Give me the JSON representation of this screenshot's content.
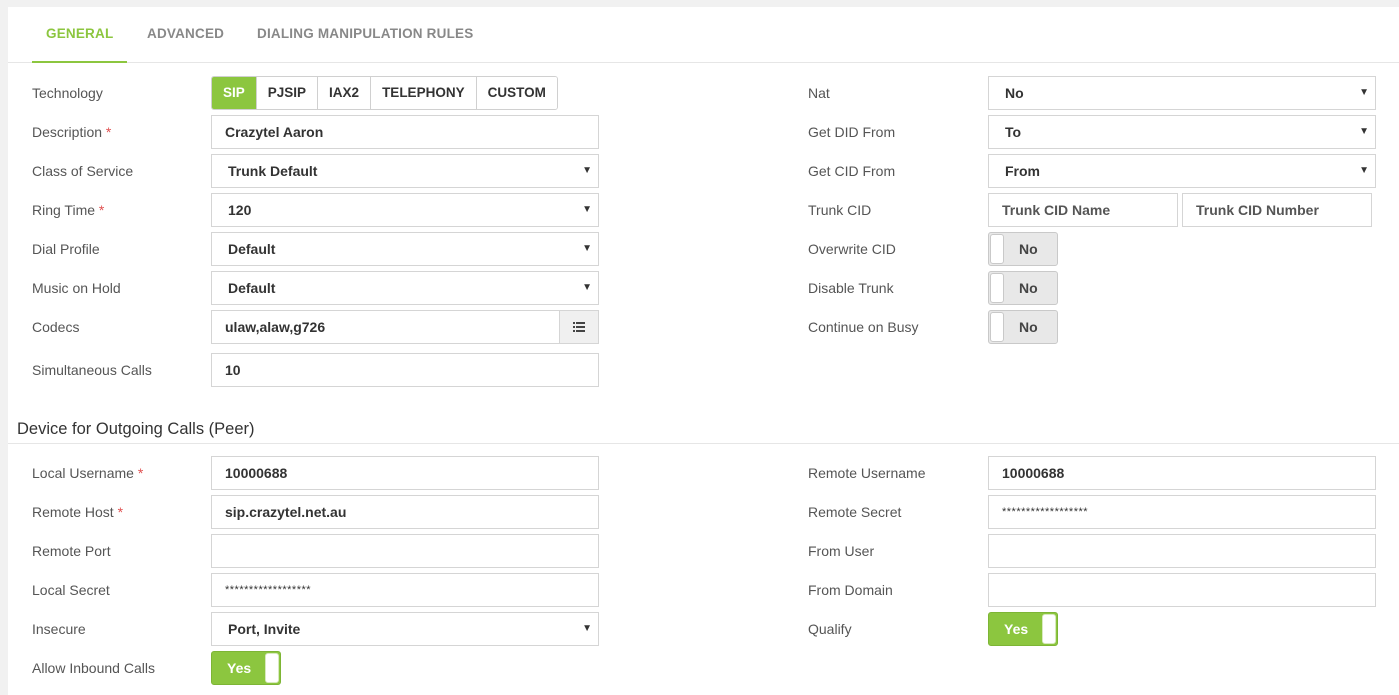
{
  "tabs": [
    "GENERAL",
    "ADVANCED",
    "DIALING MANIPULATION RULES"
  ],
  "technology": {
    "label": "Technology",
    "options": [
      "SIP",
      "PJSIP",
      "IAX2",
      "TELEPHONY",
      "CUSTOM"
    ],
    "selected": "SIP"
  },
  "description": {
    "label": "Description",
    "required": "*",
    "value": "Crazytel Aaron"
  },
  "class_of_service": {
    "label": "Class of Service",
    "value": "Trunk Default"
  },
  "ring_time": {
    "label": "Ring Time",
    "required": "*",
    "value": "120"
  },
  "dial_profile": {
    "label": "Dial Profile",
    "value": "Default"
  },
  "music_on_hold": {
    "label": "Music on Hold",
    "value": "Default"
  },
  "codecs": {
    "label": "Codecs",
    "value": "ulaw,alaw,g726",
    "icon": "list-icon"
  },
  "simultaneous_calls": {
    "label": "Simultaneous Calls",
    "value": "10"
  },
  "nat": {
    "label": "Nat",
    "value": "No"
  },
  "get_did_from": {
    "label": "Get DID From",
    "value": "To"
  },
  "get_cid_from": {
    "label": "Get CID From",
    "value": "From"
  },
  "trunk_cid": {
    "label": "Trunk CID",
    "name_placeholder": "Trunk CID Name",
    "number_placeholder": "Trunk CID Number"
  },
  "overwrite_cid": {
    "label": "Overwrite CID",
    "value": "No"
  },
  "disable_trunk": {
    "label": "Disable Trunk",
    "value": "No"
  },
  "continue_on_busy": {
    "label": "Continue on Busy",
    "value": "No"
  },
  "peer_section": {
    "title": "Device for Outgoing Calls (Peer)",
    "local_username": {
      "label": "Local Username",
      "required": "*",
      "value": "10000688"
    },
    "remote_host": {
      "label": "Remote Host",
      "required": "*",
      "value": "sip.crazytel.net.au"
    },
    "remote_port": {
      "label": "Remote Port",
      "value": ""
    },
    "local_secret": {
      "label": "Local Secret",
      "value": "******************"
    },
    "insecure": {
      "label": "Insecure",
      "value": "Port, Invite"
    },
    "allow_inbound_calls": {
      "label": "Allow Inbound Calls",
      "value": "Yes"
    },
    "remote_username": {
      "label": "Remote Username",
      "value": "10000688"
    },
    "remote_secret": {
      "label": "Remote Secret",
      "value": "******************"
    },
    "from_user": {
      "label": "From User",
      "value": ""
    },
    "from_domain": {
      "label": "From Domain",
      "value": ""
    },
    "qualify": {
      "label": "Qualify",
      "value": "Yes"
    }
  },
  "colors": {
    "accent": "#8cc63f",
    "required": "#e05050"
  }
}
